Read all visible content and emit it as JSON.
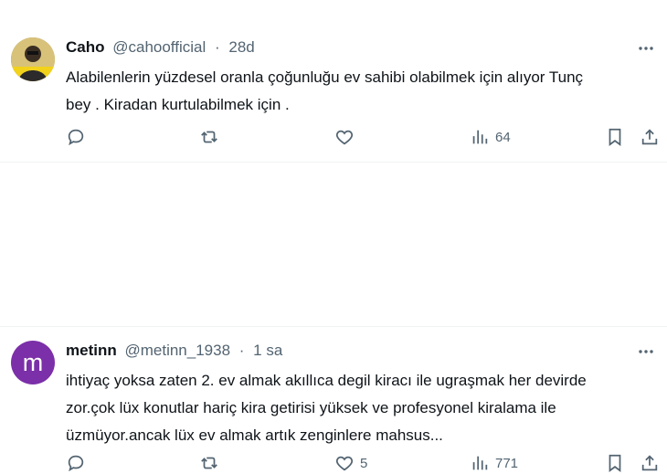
{
  "tweets": [
    {
      "name": "Caho",
      "handle": "@cahoofficial",
      "separator": "·",
      "time": "28d",
      "lines": [
        "Alabilenlerin yüzdesel oranla çoğunluğu ev sahibi olabilmek için alıyor Tunç",
        "bey . Kiradan kurtulabilmek için ."
      ],
      "likes": "",
      "views": "64"
    },
    {
      "avatar_letter": "m",
      "avatar_color": "#7b2fa8",
      "name": "metinn",
      "handle": "@metinn_1938",
      "separator": "·",
      "time": "1 sa",
      "lines": [
        "ihtiyaç yoksa zaten 2. ev almak akıllıca degil kiracı ile ugraşmak her devirde",
        "zor.çok lüx konutlar hariç kira getirisi yüksek ve profesyonel kiralama ile",
        "üzmüyor.ancak lüx ev almak artık zenginlere mahsus..."
      ],
      "likes": "5",
      "views": "771"
    }
  ],
  "icons": [
    "reply-icon",
    "retweet-icon",
    "like-icon",
    "views-icon",
    "bookmark-icon",
    "share-icon",
    "more-icon"
  ],
  "colors": {
    "text": "#0f1419",
    "secondary": "#536471",
    "divider": "#eff3f4"
  }
}
